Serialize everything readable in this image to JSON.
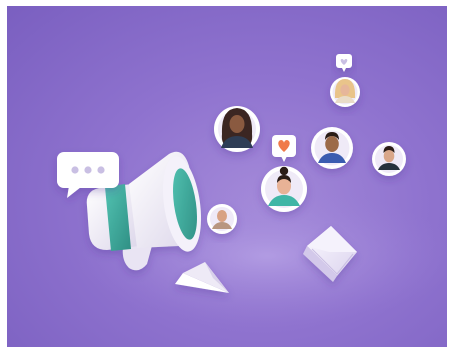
{
  "scene": {
    "description_free": true,
    "background_color": "#8f73cf",
    "accent_teal": "#3fa89a",
    "heart_color": "#f07a4a",
    "icons": [
      "megaphone-icon",
      "speech-bubble-icon",
      "paper-plane-icon",
      "envelope-icon",
      "heart-bubble-icon",
      "like-bubble-icon"
    ],
    "avatars": [
      "avatar-dark-hair-woman",
      "avatar-blonde-woman",
      "avatar-man-blue-shirt",
      "avatar-man-dark-shirt",
      "avatar-woman-teal-shirt",
      "avatar-bald-man"
    ]
  }
}
